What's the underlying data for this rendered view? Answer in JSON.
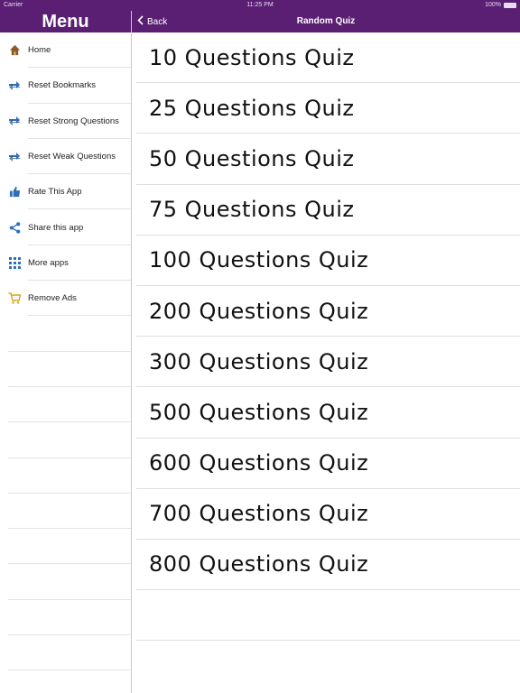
{
  "status_bar": {
    "carrier": "Carrier",
    "time": "11:25 PM",
    "battery": "100%"
  },
  "sidebar": {
    "title": "Menu",
    "items": [
      {
        "label": "Home",
        "icon": "home-icon"
      },
      {
        "label": "Reset Bookmarks",
        "icon": "reset-arrows-icon"
      },
      {
        "label": "Reset Strong Questions",
        "icon": "reset-arrows-icon"
      },
      {
        "label": "Reset Weak Questions",
        "icon": "reset-arrows-icon"
      },
      {
        "label": "Rate This App",
        "icon": "thumbs-up-icon"
      },
      {
        "label": "Share this app",
        "icon": "share-icon"
      },
      {
        "label": "More apps",
        "icon": "grid-icon"
      },
      {
        "label": "Remove Ads",
        "icon": "cart-icon"
      }
    ]
  },
  "navbar": {
    "back_label": "Back",
    "title": "Random Quiz"
  },
  "quizzes": [
    "10 Questions Quiz",
    "25 Questions Quiz",
    "50 Questions Quiz",
    "75 Questions Quiz",
    "100 Questions Quiz",
    "200 Questions Quiz",
    "300 Questions Quiz",
    "500 Questions Quiz",
    "600 Questions Quiz",
    "700 Questions Quiz",
    "800 Questions Quiz"
  ],
  "colors": {
    "accent": "#5a1f73",
    "icon_blue": "#2f6fb5"
  }
}
